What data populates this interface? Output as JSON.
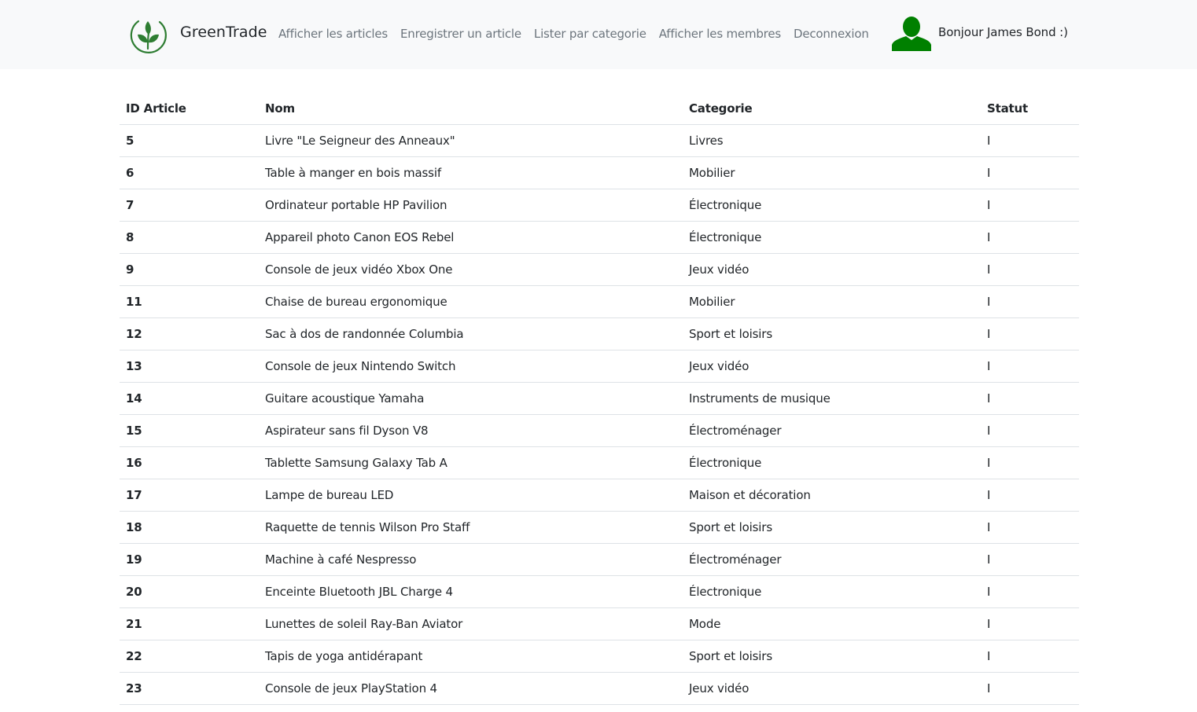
{
  "navbar": {
    "brand": "GreenTrade",
    "links": [
      "Afficher les articles",
      "Enregistrer un article",
      "Lister par categorie",
      "Afficher les membres",
      "Deconnexion"
    ],
    "greeting": "Bonjour James Bond :)",
    "brand_color": "#2e7d32",
    "avatar_color": "#008000"
  },
  "table": {
    "headers": {
      "id": "ID Article",
      "nom": "Nom",
      "categorie": "Categorie",
      "statut": "Statut"
    },
    "rows": [
      {
        "id": "5",
        "nom": "Livre \"Le Seigneur des Anneaux\"",
        "categorie": "Livres",
        "statut": "I"
      },
      {
        "id": "6",
        "nom": "Table à manger en bois massif",
        "categorie": "Mobilier",
        "statut": "I"
      },
      {
        "id": "7",
        "nom": "Ordinateur portable HP Pavilion",
        "categorie": "Électronique",
        "statut": "I"
      },
      {
        "id": "8",
        "nom": "Appareil photo Canon EOS Rebel",
        "categorie": "Électronique",
        "statut": "I"
      },
      {
        "id": "9",
        "nom": "Console de jeux vidéo Xbox One",
        "categorie": "Jeux vidéo",
        "statut": "I"
      },
      {
        "id": "11",
        "nom": "Chaise de bureau ergonomique",
        "categorie": "Mobilier",
        "statut": "I"
      },
      {
        "id": "12",
        "nom": "Sac à dos de randonnée Columbia",
        "categorie": "Sport et loisirs",
        "statut": "I"
      },
      {
        "id": "13",
        "nom": "Console de jeux Nintendo Switch",
        "categorie": "Jeux vidéo",
        "statut": "I"
      },
      {
        "id": "14",
        "nom": "Guitare acoustique Yamaha",
        "categorie": "Instruments de musique",
        "statut": "I"
      },
      {
        "id": "15",
        "nom": "Aspirateur sans fil Dyson V8",
        "categorie": "Électroménager",
        "statut": "I"
      },
      {
        "id": "16",
        "nom": "Tablette Samsung Galaxy Tab A",
        "categorie": "Électronique",
        "statut": "I"
      },
      {
        "id": "17",
        "nom": "Lampe de bureau LED",
        "categorie": "Maison et décoration",
        "statut": "I"
      },
      {
        "id": "18",
        "nom": "Raquette de tennis Wilson Pro Staff",
        "categorie": "Sport et loisirs",
        "statut": "I"
      },
      {
        "id": "19",
        "nom": "Machine à café Nespresso",
        "categorie": "Électroménager",
        "statut": "I"
      },
      {
        "id": "20",
        "nom": "Enceinte Bluetooth JBL Charge 4",
        "categorie": "Électronique",
        "statut": "I"
      },
      {
        "id": "21",
        "nom": "Lunettes de soleil Ray-Ban Aviator",
        "categorie": "Mode",
        "statut": "I"
      },
      {
        "id": "22",
        "nom": "Tapis de yoga antidérapant",
        "categorie": "Sport et loisirs",
        "statut": "I"
      },
      {
        "id": "23",
        "nom": "Console de jeux PlayStation 4",
        "categorie": "Jeux vidéo",
        "statut": "I"
      }
    ]
  }
}
